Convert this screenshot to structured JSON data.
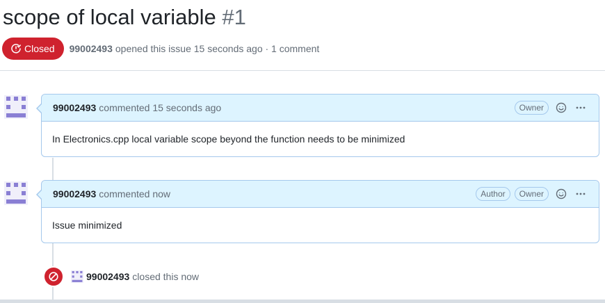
{
  "issue": {
    "title": "scope of local variable",
    "number": "#1",
    "state_label": "Closed",
    "author": "99002493",
    "opened_text": "opened this issue 15 seconds ago · 1 comment"
  },
  "comments": [
    {
      "author": "99002493",
      "time_text": "commented 15 seconds ago",
      "labels": [
        "Owner"
      ],
      "body": "In Electronics.cpp local variable scope beyond the function needs to be minimized"
    },
    {
      "author": "99002493",
      "time_text": "commented now",
      "labels": [
        "Author",
        "Owner"
      ],
      "body": "Issue minimized"
    }
  ],
  "event": {
    "author": "99002493",
    "text": "closed this now"
  },
  "colors": {
    "closed": "#cf222e",
    "avatar": "#8a7fd4",
    "header_bg": "#ddf4ff",
    "border": "#a4c8ec"
  },
  "icons": [
    "issue-closed-icon",
    "smiley-icon",
    "kebab-horizontal-icon",
    "skip-icon",
    "identicon-avatar"
  ]
}
